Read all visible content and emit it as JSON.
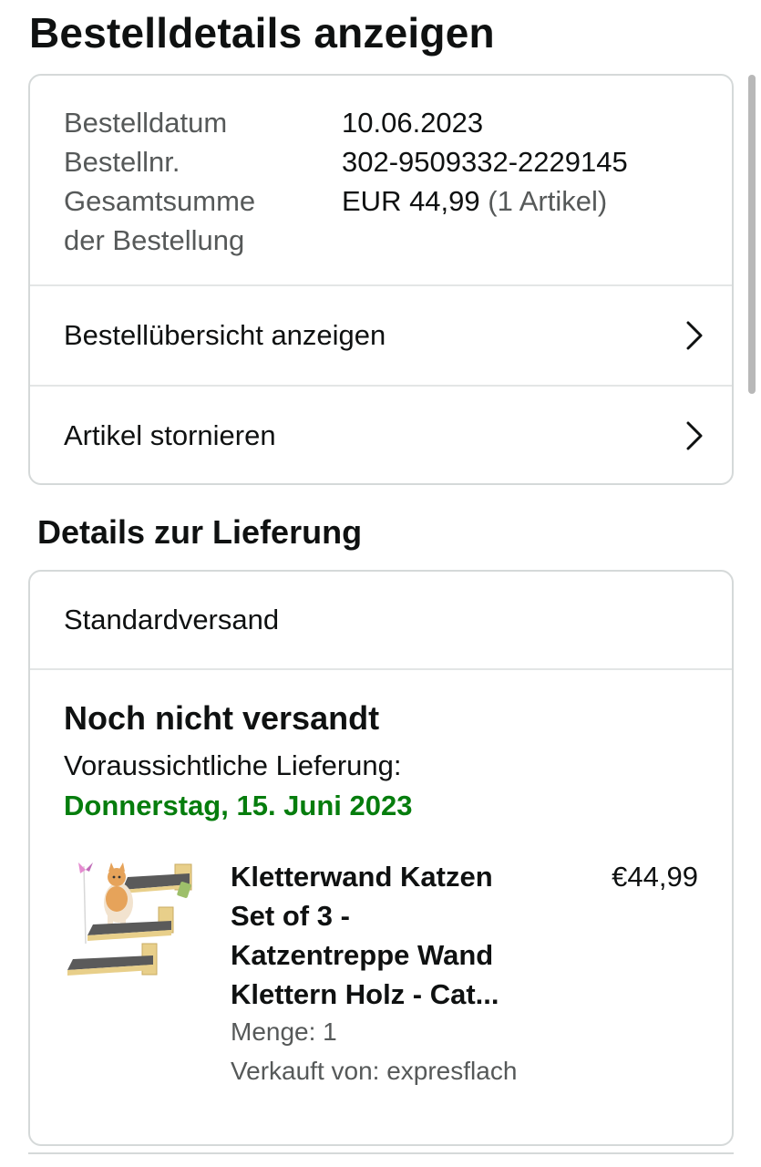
{
  "header": {
    "title": "Bestelldetails anzeigen"
  },
  "order_summary": {
    "rows": [
      {
        "label": "Bestelldatum",
        "value": "10.06.2023"
      },
      {
        "label": "Bestellnr.",
        "value": "302-9509332-2229145"
      },
      {
        "label": "Gesamtsumme\nder Bestellung",
        "value": "EUR 44,99",
        "extra": " (1 Artikel)"
      }
    ],
    "label_line1": "Gesamtsumme",
    "label_line2": "der Bestellung"
  },
  "actions": {
    "view_summary": "Bestellübersicht anzeigen",
    "cancel_items": "Artikel stornieren"
  },
  "delivery": {
    "section_title": "Details zur Lieferung",
    "method": "Standardversand",
    "status": "Noch nicht versandt",
    "eta_label": "Voraussichtliche Lieferung:",
    "eta_date": "Donnerstag, 15. Juni 2023",
    "eta_color": "#067d0d"
  },
  "product": {
    "title_lines": [
      "Kletterwand Katzen",
      "Set of 3 -",
      "Katzentreppe Wand",
      "Klettern Holz - Cat..."
    ],
    "price": "€44,99",
    "quantity": "Menge: 1",
    "seller": "Verkauft von: expresflach",
    "image_icon": "cat-wall-steps-image"
  }
}
